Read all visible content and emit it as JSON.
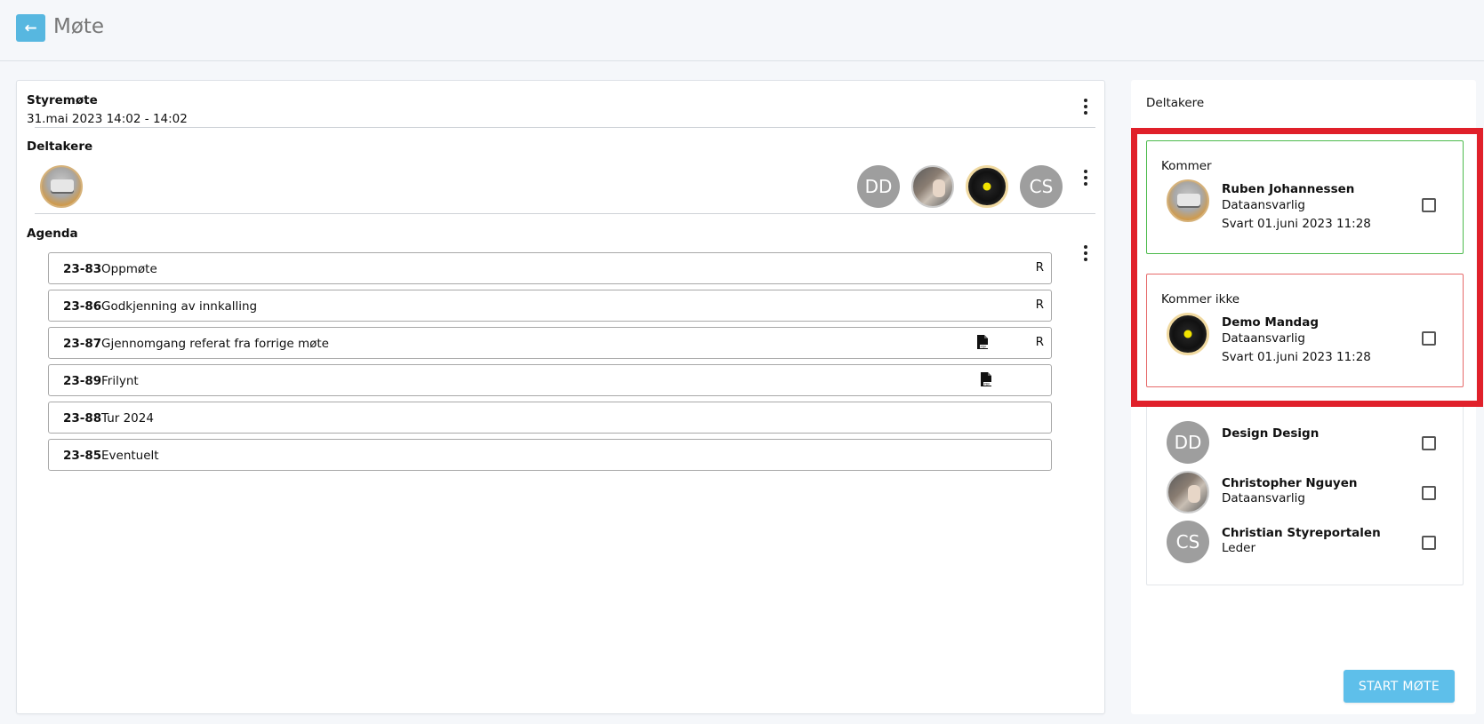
{
  "header": {
    "back_icon": "arrow-left-icon",
    "title": "Møte"
  },
  "meeting": {
    "title": "Styremøte",
    "time": "31.mai 2023 14:02 - 14:02"
  },
  "participants_section": {
    "label": "Deltakere",
    "organizer_avatar": "printer-photo",
    "avatars": [
      {
        "type": "initials",
        "text": "DD"
      },
      {
        "type": "photo",
        "text": ""
      },
      {
        "type": "vinyl",
        "text": ""
      },
      {
        "type": "initials",
        "text": "CS"
      }
    ]
  },
  "agenda": {
    "label": "Agenda",
    "items": [
      {
        "num": "23-83",
        "title": "Oppmøte",
        "pdf": false,
        "r": "R"
      },
      {
        "num": "23-86",
        "title": "Godkjenning av innkalling",
        "pdf": false,
        "r": "R"
      },
      {
        "num": "23-87",
        "title": "Gjennomgang referat fra forrige møte",
        "pdf": true,
        "r": "R"
      },
      {
        "num": "23-89",
        "title": "Frilynt",
        "pdf": true,
        "r": ""
      },
      {
        "num": "23-88",
        "title": "Tur 2024",
        "pdf": false,
        "r": ""
      },
      {
        "num": "23-85",
        "title": "Eventuelt",
        "pdf": false,
        "r": ""
      }
    ]
  },
  "right_panel": {
    "title": "Deltakere",
    "coming": {
      "label": "Kommer",
      "name": "Ruben Johannessen",
      "role": "Dataansvarlig",
      "responded": "Svart 01.juni 2023 11:28"
    },
    "not_coming": {
      "label": "Kommer ikke",
      "name": "Demo Mandag",
      "role": "Dataansvarlig",
      "responded": "Svart 01.juni 2023 11:28"
    },
    "others": [
      {
        "initials": "DD",
        "name": "Design Design",
        "role": ""
      },
      {
        "initials": "",
        "name": "Christopher Nguyen",
        "role": "Dataansvarlig"
      },
      {
        "initials": "CS",
        "name": "Christian Styreportalen",
        "role": "Leder"
      }
    ],
    "start_button": "START MØTE"
  },
  "colors": {
    "accent": "#57b7e0",
    "highlight": "#e0202a",
    "coming_border": "#4cbb4c",
    "not_coming_border": "#e66a6a"
  }
}
